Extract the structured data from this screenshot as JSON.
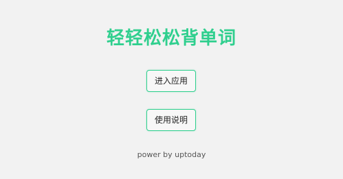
{
  "app": {
    "title": "轻轻松松背单词"
  },
  "buttons": {
    "enter_label": "进入应用",
    "help_label": "使用说明"
  },
  "footer": {
    "credit": "power by uptoday"
  },
  "colors": {
    "background": "#f2f2f2",
    "accent": "#2fcf8e",
    "text": "#222222"
  }
}
